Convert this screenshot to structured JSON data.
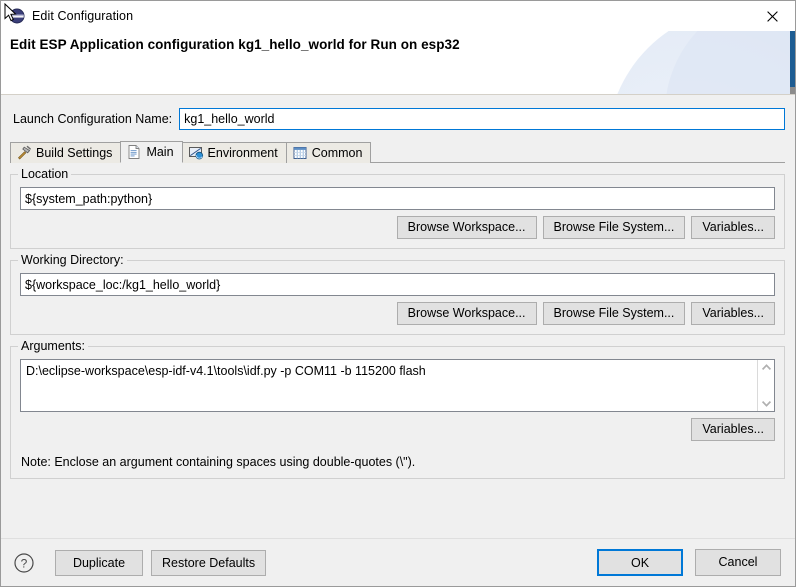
{
  "window": {
    "title": "Edit Configuration",
    "title_icon": "launch-config-icon",
    "close_icon": "close-icon",
    "cursor_icon": "mouse-pointer-icon"
  },
  "header": {
    "heading": "Edit ESP Application configuration kg1_hello_world for Run on esp32",
    "accent_color": "#1d5c92"
  },
  "launch_name": {
    "label": "Launch Configuration Name:",
    "value": "kg1_hello_world",
    "focus_color": "#0078d7"
  },
  "tabs": [
    {
      "label": "Build Settings",
      "icon": "hammer-icon",
      "selected": false
    },
    {
      "label": "Main",
      "icon": "document-icon",
      "selected": true
    },
    {
      "label": "Environment",
      "icon": "monitor-icon",
      "selected": false
    },
    {
      "label": "Common",
      "icon": "table-window-icon",
      "selected": false
    }
  ],
  "location": {
    "group_title": "Location",
    "value": "${system_path:python}",
    "buttons": [
      "Browse Workspace...",
      "Browse File System...",
      "Variables..."
    ]
  },
  "working_directory": {
    "group_title": "Working Directory:",
    "value": "${workspace_loc:/kg1_hello_world}",
    "buttons": [
      "Browse Workspace...",
      "Browse File System...",
      "Variables..."
    ]
  },
  "arguments": {
    "group_title": "Arguments:",
    "value": "D:\\eclipse-workspace\\esp-idf-v4.1\\tools\\idf.py -p COM11 -b 115200 flash",
    "buttons": [
      "Variables..."
    ],
    "scroll_up_icon": "chevron-up-icon",
    "scroll_down_icon": "chevron-down-icon",
    "note": "Note: Enclose an argument containing spaces using double-quotes (\\\")."
  },
  "footer": {
    "help_icon": "help-question-icon",
    "duplicate": "Duplicate",
    "restore_defaults": "Restore Defaults",
    "ok": "OK",
    "cancel": "Cancel",
    "default_button_color": "#0078d7"
  }
}
